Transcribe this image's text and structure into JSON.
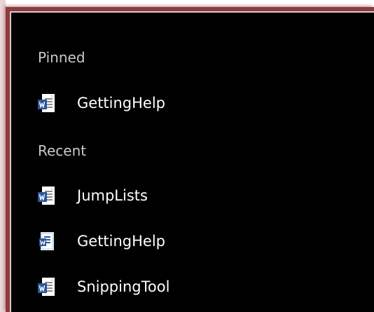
{
  "jump_list": {
    "pinned_header": "Pinned",
    "recent_header": "Recent",
    "pinned_items": [
      {
        "label": "GettingHelp",
        "icon": "word-document-icon"
      }
    ],
    "recent_items": [
      {
        "label": "JumpLists",
        "icon": "word-document-icon"
      },
      {
        "label": "GettingHelp",
        "icon": "word-template-icon"
      },
      {
        "label": "SnippingTool",
        "icon": "word-document-icon"
      }
    ]
  },
  "colors": {
    "background": "#000000",
    "frame_accent": "#8f3940",
    "header_text": "#c9c9c9",
    "item_text": "#ffffff",
    "word_blue": "#2b579a"
  }
}
